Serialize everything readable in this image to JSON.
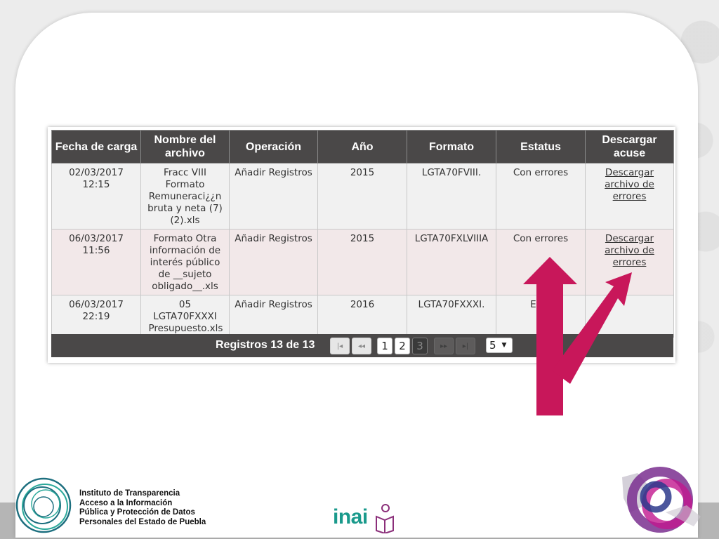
{
  "table": {
    "headers": [
      "Fecha de carga",
      "Nombre del archivo",
      "Operación",
      "Año",
      "Formato",
      "Estatus",
      "Descargar acuse"
    ],
    "rows": [
      {
        "fecha": "02/03/2017 12:15",
        "archivo": "Fracc VIII Formato Remuneraci¿¿n bruta y neta (7) (2).xls",
        "operacion": "Añadir Registros",
        "anio": "2015",
        "formato": "LGTA70FVIII.",
        "estatus": "Con errores",
        "acuse": "Descargar archivo de errores"
      },
      {
        "fecha": "06/03/2017 11:56",
        "archivo": "Formato Otra información de interés público de __sujeto obligado__.xls",
        "operacion": "Añadir Registros",
        "anio": "2015",
        "formato": "LGTA70FXLVIIIA",
        "estatus": "Con errores",
        "acuse": "Descargar archivo de errores"
      },
      {
        "fecha": "06/03/2017 22:19",
        "archivo": "05 LGTA70FXXXI Presupuesto.xls",
        "operacion": "Añadir Registros",
        "anio": "2016",
        "formato": "LGTA70FXXXI.",
        "estatus": "En e",
        "acuse": ""
      }
    ]
  },
  "pager": {
    "label": "Registros 13 de 13",
    "first_icon": "first-page-icon",
    "prev_icon": "prev-page-icon",
    "next_icon": "next-page-icon",
    "last_icon": "last-page-icon",
    "pages": [
      "1",
      "2",
      "3"
    ],
    "active_page": "3",
    "page_size": "5"
  },
  "footer": {
    "institute_lines": [
      "Instituto de Transparencia",
      "Acceso a la Información",
      "Pública y Protección de Datos",
      "Personales del Estado de Puebla"
    ],
    "inai_logo": "inai"
  },
  "colors": {
    "header_bg": "#4a4848",
    "row_odd": "#f1f1f1",
    "row_even": "#f2e8e9",
    "arrow": "#c8175a"
  }
}
